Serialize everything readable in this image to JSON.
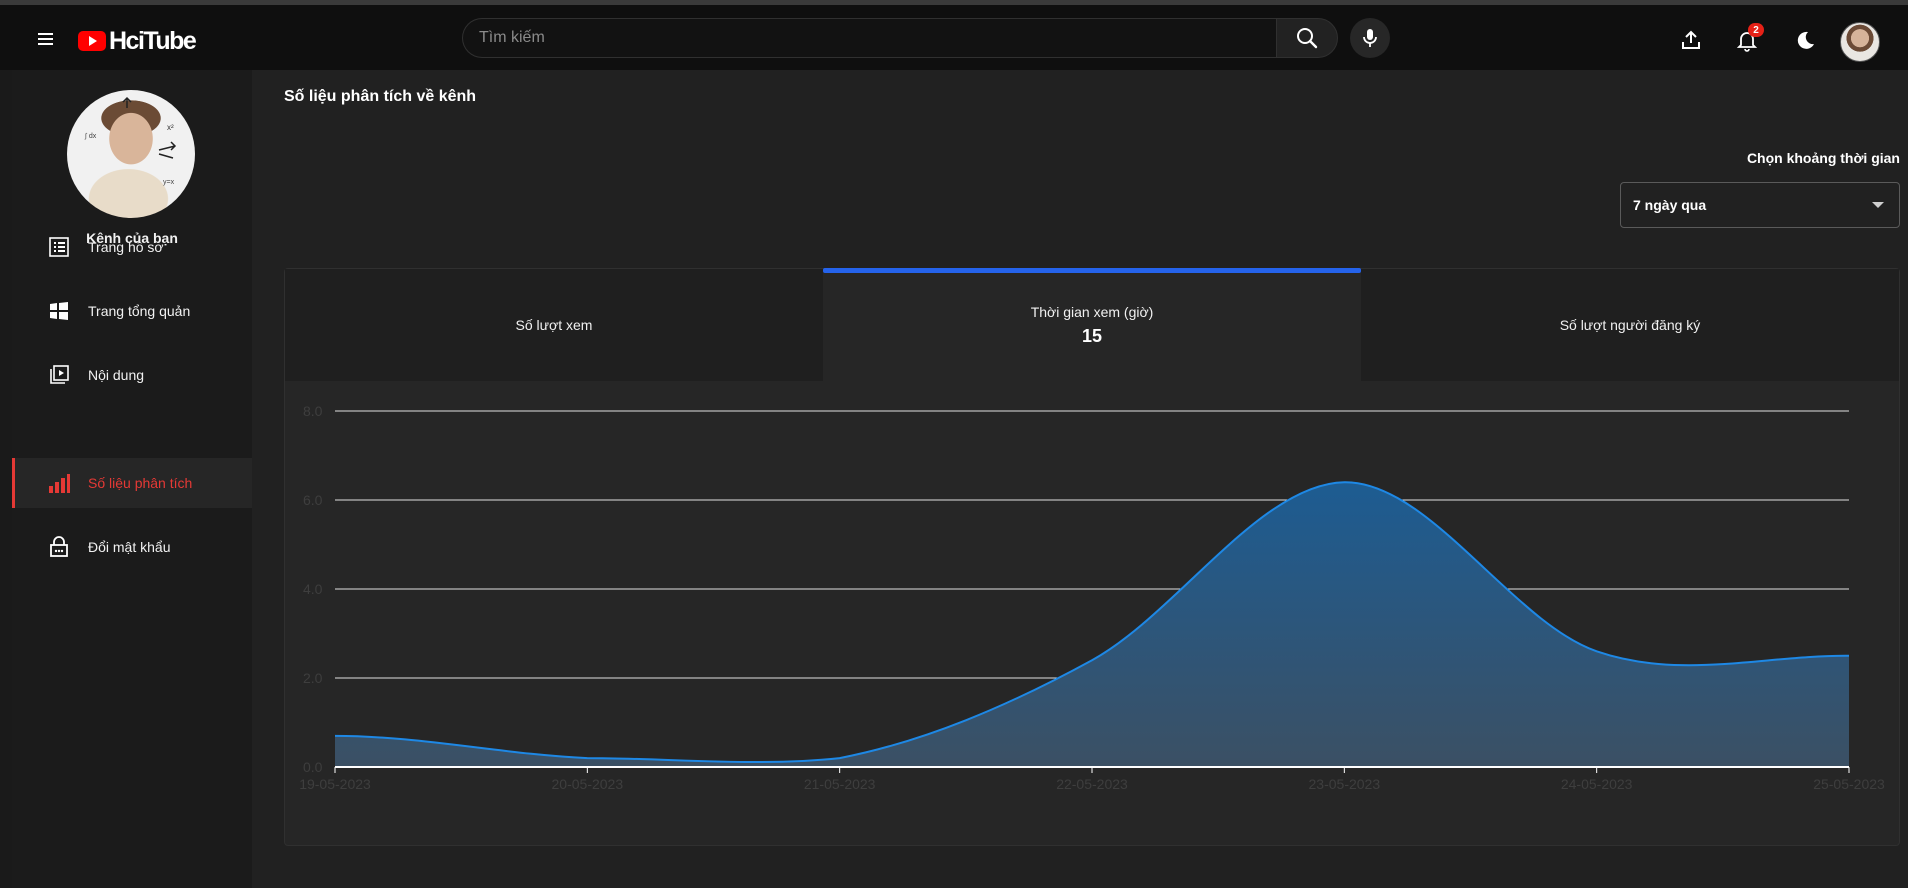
{
  "app": {
    "logo_text": "HciTube",
    "brand_color": "#ff0000",
    "search": {
      "placeholder": "Tìm kiếm",
      "value": ""
    },
    "notifications": {
      "count": "2"
    },
    "icons": [
      "menu-icon",
      "search-icon",
      "mic-icon",
      "upload-icon",
      "bell-icon",
      "moon-icon"
    ]
  },
  "sidebar": {
    "channel_label": "Kênh của bạn",
    "items": [
      {
        "label": "Trang hồ sơ",
        "icon": "profile-list-icon",
        "active": false
      },
      {
        "label": "Trang tổng quản",
        "icon": "dashboard-icon",
        "active": false
      },
      {
        "label": "Nội dung",
        "icon": "content-icon",
        "active": false
      },
      {
        "label": "Số liệu phân tích",
        "icon": "analytics-icon",
        "active": true
      },
      {
        "label": "Đổi mật khẩu",
        "icon": "lock-icon",
        "active": false
      }
    ],
    "active_color": "#e53935"
  },
  "main": {
    "title": "Số liệu phân tích về kênh",
    "range": {
      "label": "Chọn khoảng thời gian",
      "value": "7 ngày qua"
    },
    "tabs": [
      {
        "label": "Số lượt xem",
        "value": ""
      },
      {
        "label": "Thời gian xem (giờ)",
        "value": "15",
        "active": true
      },
      {
        "label": "Số lượt người đăng ký",
        "value": ""
      }
    ],
    "tab_accent": "#2563eb"
  },
  "chart_data": {
    "type": "area",
    "x": [
      "19-05-2023",
      "20-05-2023",
      "21-05-2023",
      "22-05-2023",
      "23-05-2023",
      "24-05-2023",
      "25-05-2023"
    ],
    "y_ticks": [
      "0.0",
      "2.0",
      "4.0",
      "6.0",
      "8.0"
    ],
    "series": [
      {
        "values": [
          0.7,
          0.2,
          0.2,
          2.4,
          6.4,
          2.6,
          2.5
        ]
      }
    ],
    "ylim": [
      0,
      8
    ],
    "grid": true,
    "line_color": "#1e88e5"
  }
}
